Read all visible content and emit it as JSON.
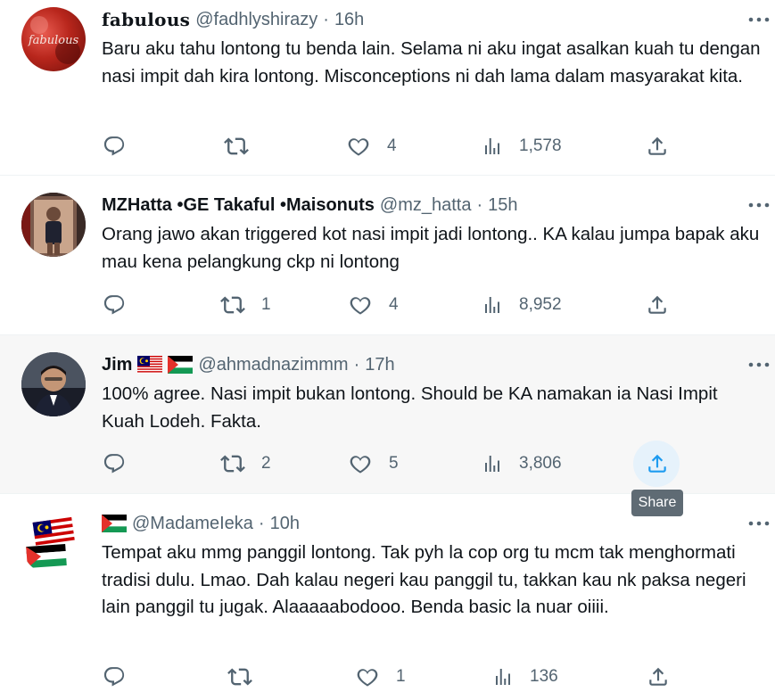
{
  "tweets": [
    {
      "name": "fabulous",
      "handle": "@fadhlyshirazy",
      "time": "16h",
      "avatar_text": "fabulous",
      "text": "Baru aku tahu lontong tu benda lain. Selama ni aku ingat asalkan kuah tu dengan nasi impit dah kira lontong. Misconceptions ni dah lama dalam masyarakat kita.",
      "replies": "",
      "retweets": "",
      "likes": "4",
      "views": "1,578"
    },
    {
      "name": "MZHatta •GE Takaful •Maisonuts",
      "handle": "@mz_hatta",
      "time": "15h",
      "text": "Orang jawo akan triggered kot nasi impit jadi lontong.. KA kalau jumpa bapak aku mau kena pelangkung ckp ni lontong",
      "replies": "",
      "retweets": "1",
      "likes": "4",
      "views": "8,952"
    },
    {
      "name": "Jim",
      "handle": "@ahmadnazimmm",
      "time": "17h",
      "text": "100% agree. Nasi impit bukan lontong. Should be KA namakan ia Nasi Impit Kuah Lodeh. Fakta.",
      "replies": "",
      "retweets": "2",
      "likes": "5",
      "views": "3,806"
    },
    {
      "name": "",
      "handle": "@MadameIeka",
      "time": "10h",
      "text": "Tempat aku mmg panggil lontong. Tak pyh la cop org tu mcm tak menghormati tradisi dulu. Lmao. Dah kalau negeri kau panggil tu, takkan kau nk paksa negeri lain panggil tu jugak. Alaaaaabodooo. Benda basic la nuar oiiii.",
      "replies": "",
      "retweets": "",
      "likes": "1",
      "views": "136"
    }
  ],
  "separator": "·",
  "tooltip": "Share",
  "colors": {
    "text": "#0f1419",
    "secondary": "#536471",
    "hover_bg": "#f7f7f7",
    "accent": "#1d9bf0"
  },
  "icons": [
    "reply-icon",
    "retweet-icon",
    "like-icon",
    "views-icon",
    "share-icon",
    "more-icon"
  ]
}
